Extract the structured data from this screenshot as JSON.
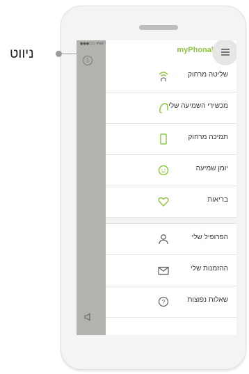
{
  "callout": {
    "label": "ניווט"
  },
  "status_bar": {
    "text": "●●●○○ iPad ᯤ"
  },
  "drawer": {
    "brand": "myPhonak",
    "brand_color": "#8cc63f",
    "menu_icon": "hamburger-menu-icon",
    "items": [
      {
        "label": "שליטה מרחוק",
        "icon": "remote-signal-icon"
      },
      {
        "label": "מכשירי השמיעה שלי",
        "icon": "hearing-aid-icon"
      },
      {
        "label": "תמיכה מרחוק",
        "icon": "phone-icon"
      },
      {
        "label": "יומן שמיעה",
        "icon": "smiley-icon"
      },
      {
        "label": "בריאות",
        "icon": "heart-icon"
      },
      {
        "label": "הפרופיל שלי",
        "icon": "person-icon"
      },
      {
        "label": "ההזמנות שלי",
        "icon": "envelope-icon"
      },
      {
        "label": "שאלות נפוצות",
        "icon": "question-icon"
      }
    ]
  },
  "side_panel": {
    "info_icon": "info-icon",
    "volume_icon": "speaker-icon"
  }
}
